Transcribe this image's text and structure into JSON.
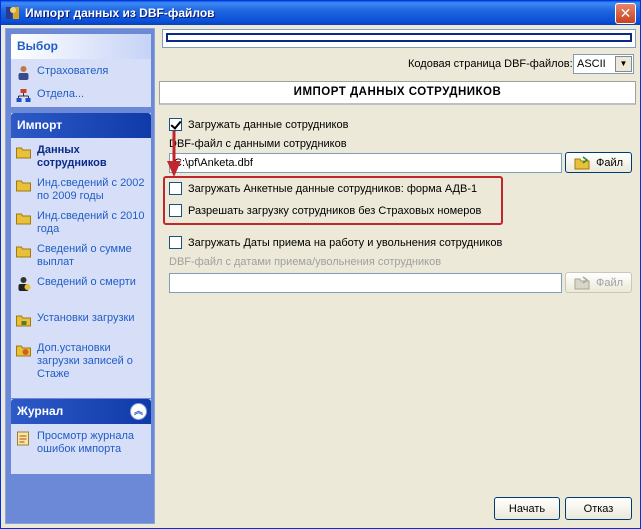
{
  "window": {
    "title": "Импорт данных из DBF-файлов",
    "close_symbol": "✕"
  },
  "sidebar": {
    "selection": {
      "header": "Выбор",
      "items": [
        {
          "label": "Страхователя",
          "icon": "person-icon"
        },
        {
          "label": "Отдела...",
          "icon": "org-chart-icon"
        }
      ]
    },
    "import": {
      "header": "Импорт",
      "items": [
        {
          "label": "Данных сотрудников",
          "icon": "folder-icon",
          "active": true
        },
        {
          "label": "Инд.сведений с 2002 по 2009 годы",
          "icon": "folder-icon"
        },
        {
          "label": "Инд.сведений с 2010 года",
          "icon": "folder-icon"
        },
        {
          "label": "Сведений о сумме выплат",
          "icon": "folder-icon"
        },
        {
          "label": "Сведений о смерти",
          "icon": "person-dark-icon"
        },
        {
          "label": "Установки загрузки",
          "icon": "folder-lock-icon"
        },
        {
          "label": "Доп.установки загрузки записей о Стаже",
          "icon": "gear-folder-icon"
        }
      ]
    },
    "journal": {
      "header": "Журнал",
      "collapse_symbol": "︽",
      "items": [
        {
          "label": "Просмотр журнала ошибок импорта",
          "icon": "notepad-icon"
        }
      ]
    }
  },
  "main": {
    "codepage_label": "Кодовая страница DBF-файлов:",
    "codepage_value": "ASCII",
    "dropdown_symbol": "▼",
    "section_title": "ИМПОРТ ДАННЫХ СОТРУДНИКОВ",
    "load_employees": {
      "label": "Загружать данные сотрудников",
      "checked": true
    },
    "dbf_employees_label": "DBF-файл с данными сотрудников",
    "dbf_employees_path": "C:\\pf\\Anketa.dbf",
    "file_button": "Файл",
    "load_adv1": {
      "label": "Загружать Анкетные данные сотрудников: форма АДВ-1",
      "checked": false
    },
    "allow_no_insurance": {
      "label": "Разрешать загрузку сотрудников без Страховых номеров",
      "checked": false
    },
    "load_dates": {
      "label": "Загружать Даты приема на работу и увольнения сотрудников",
      "checked": false
    },
    "dbf_dates_label": "DBF-файл с датами приема/увольнения сотрудников",
    "dbf_dates_path": "",
    "file_button_disabled": "Файл"
  },
  "footer": {
    "start_button": "Начать",
    "cancel_button": "Отказ"
  },
  "colors": {
    "accent": "#215dc6",
    "highlight": "#c0262c",
    "sidebar_bg": "#6b89d6"
  }
}
